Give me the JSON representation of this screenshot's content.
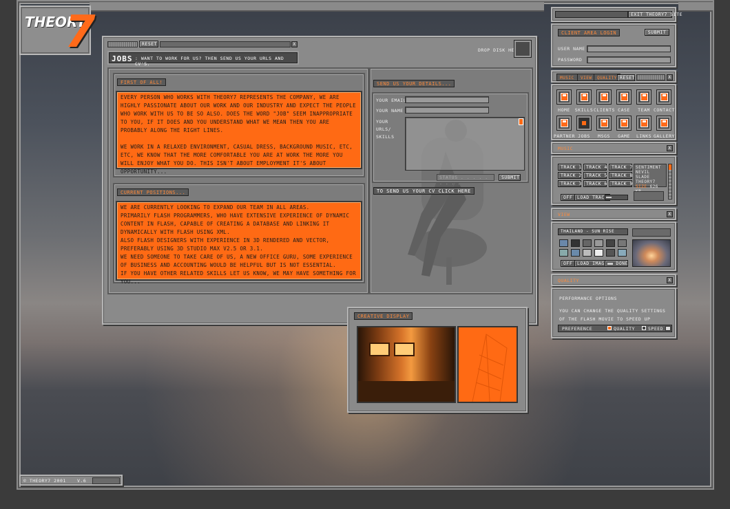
{
  "logo": {
    "text": "Theory",
    "seven": "7"
  },
  "jobs_window": {
    "reset_label": "Reset",
    "title": "Jobs",
    "subtitle": ": want to work for us? then send us your urls and cv's.",
    "drop_disk": "Drop disk here",
    "first_of_all": {
      "heading": "First of all!",
      "paragraphs": [
        "Every person who works with theory7 represents the company, we are highly passionate about our work and our industry and expect the people who work with us to be so also.  Does the word \"job\" seem inappropriate to you, if it does and you understand what we mean then you are probably along the right lines.",
        "We work in a relaxed environment, casual dress, background music, etc, etc, we know that the more comfortable you are at work the more you will enjoy what you do.  This isn't about employment it's about opportunity..."
      ]
    },
    "current_positions": {
      "heading": "Current positions...",
      "lines": [
        "We are currently looking to expand our team in all areas.",
        "Primarily flash programmers, who have extensive experience of dynamic content in flash, capable of creating a database and linking it dynamically with flash using xml.",
        "Also flash designers with experience in 3d rendered and vector, preferably using 3d studio max v2.5 or 3.1.",
        "We need someone to take care of us, a new office guru, some experience of business and accounting would be helpful but is not essential.",
        "If you have other related skills let us know, we may have something for you..."
      ]
    },
    "send_details": {
      "heading": "Send us your details...",
      "email_label": "Your email",
      "name_label": "Your name",
      "urls_label": "Your urls/ skills",
      "status_placeholder": "Status . . . . . . . . .",
      "submit_label": "Submit",
      "cv_link": "To send us your cv click here"
    }
  },
  "creative_display": {
    "heading": "Creative display"
  },
  "right_panel": {
    "exit_label": "Exit theory7 site",
    "client_login": {
      "heading": "Client area login",
      "submit_label": "Submit",
      "username_label": "User name",
      "password_label": "Password"
    },
    "tabs": {
      "music": "Music",
      "view": "View",
      "quality": "Quality",
      "reset": "Reset"
    },
    "nav_row1": [
      "Home",
      "Skills",
      "Clients",
      "Case",
      "Team",
      "Contact"
    ],
    "nav_row2": [
      "Partner",
      "Jobs",
      "Msgs",
      "Game",
      "Links",
      "Gallery"
    ],
    "music": {
      "heading": "Music",
      "tracks": [
        "Track 1",
        "Track 4",
        "Track 7",
        "Track 2",
        "Track 5",
        "Track 8",
        "Track 3",
        "Track 6",
        "Track 9"
      ],
      "now_playing": [
        "Sentiment",
        "Nevil Slade",
        "Theory7"
      ],
      "size_label": "Size",
      "size_value": "626 kb",
      "off_label": "Off",
      "load_label": "Load track"
    },
    "view": {
      "heading": "View",
      "image_title": "Thailand - sun rise",
      "off_label": "Off",
      "load_label": "Load image",
      "done_label": "Done"
    },
    "quality": {
      "heading": "Quality",
      "title": "Performance options",
      "description": "You can change the quality settings of the flash movie to speed up animations.",
      "preference_label": "Preference",
      "quality_option": "Quality",
      "speed_option": "Speed"
    }
  },
  "footer": {
    "copyright": "© Theory7 2001",
    "version": "v.6"
  },
  "colors": {
    "accent": "#ff6a14",
    "panel": "#8a8a8a"
  }
}
